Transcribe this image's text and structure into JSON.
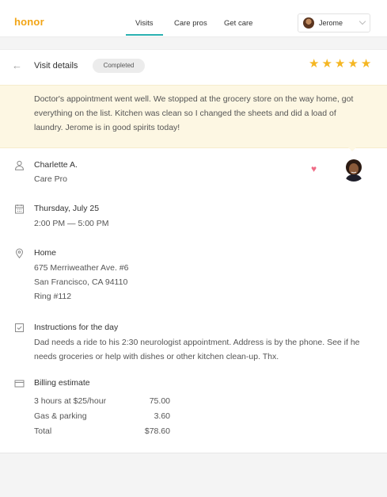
{
  "brand": {
    "logo": "honor",
    "accent": "#f2a516",
    "teal": "#2bb1b1"
  },
  "nav": [
    {
      "label": "Visits",
      "active": true
    },
    {
      "label": "Care pros",
      "active": false
    },
    {
      "label": "Get care",
      "active": false
    }
  ],
  "user": {
    "name": "Jerome"
  },
  "visit": {
    "title": "Visit details",
    "status": "Completed",
    "rating": 5,
    "note": "Doctor's appointment went well. We stopped at the grocery store on the way home, got everything on the list. Kitchen was clean so I changed the sheets and did a load of laundry. Jerome is in good spirits today!",
    "care_pro": {
      "name": "Charlette A.",
      "role": "Care Pro",
      "favorited": true
    },
    "schedule": {
      "date": "Thursday, July 25",
      "time": "2:00 PM — 5:00 PM"
    },
    "location": {
      "title": "Home",
      "line1": "675 Merriweather Ave. #6",
      "line2": "San Francisco, CA 94110",
      "line3": "Ring #112"
    },
    "instructions": {
      "title": "Instructions for the day",
      "text": "Dad needs a ride to his 2:30 neurologist appointment. Address is by the phone. See if he needs groceries or help with dishes or other kitchen clean-up. Thx."
    },
    "billing": {
      "title": "Billing estimate",
      "items": [
        {
          "label": "3 hours at $25/hour",
          "amount": "75.00"
        },
        {
          "label": "Gas & parking",
          "amount": "3.60"
        },
        {
          "label": "Total",
          "amount": "$78.60"
        }
      ]
    }
  }
}
